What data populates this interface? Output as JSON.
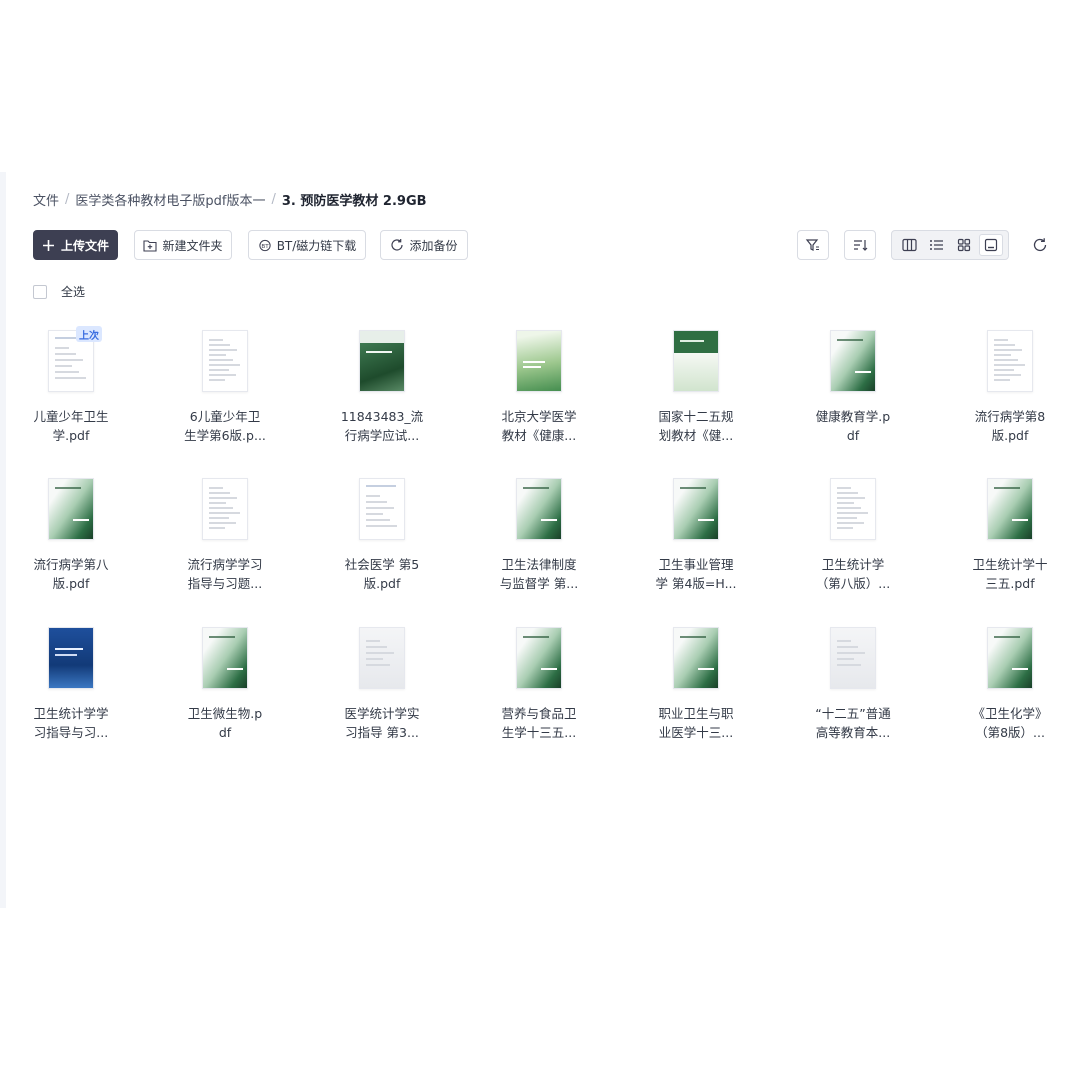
{
  "breadcrumb": {
    "root": "文件",
    "parent": "医学类各种教材电子版pdf版本一",
    "current": "3. 预防医学教材 2.9GB"
  },
  "toolbar": {
    "upload_label": "上传文件",
    "new_folder_label": "新建文件夹",
    "bt_label": "BT/磁力链下载",
    "backup_label": "添加备份",
    "filter_icon": "filter-icon",
    "sort_icon": "sort-icon",
    "views": [
      "column-view-icon",
      "list-view-icon",
      "grid-view-icon",
      "thumbnail-view-icon"
    ],
    "refresh_icon": "refresh-icon"
  },
  "select_all_label": "全选",
  "badge_label": "上次",
  "files": [
    {
      "name1": "儿童少年卫生",
      "name2": "学.pdf",
      "style": "plain"
    },
    {
      "name1": "6儿童少年卫",
      "name2": "生学第6版.p...",
      "style": "doc"
    },
    {
      "name1": "11843483_流",
      "name2": "行病学应试...",
      "style": "green-dark"
    },
    {
      "name1": "北京大学医学",
      "name2": "教材《健康...",
      "style": "green-light"
    },
    {
      "name1": "国家十二五规",
      "name2": "划教材《健...",
      "style": "green-top"
    },
    {
      "name1": "健康教育学.p",
      "name2": "df",
      "style": "green-fade"
    },
    {
      "name1": "流行病学第8",
      "name2": "版.pdf",
      "style": "doc"
    },
    {
      "name1": "流行病学第八",
      "name2": "版.pdf",
      "style": "green-fade"
    },
    {
      "name1": "流行病学学习",
      "name2": "指导与习题...",
      "style": "doc"
    },
    {
      "name1": "社会医学 第5",
      "name2": "版.pdf",
      "style": "plain"
    },
    {
      "name1": "卫生法律制度",
      "name2": "与监督学 第...",
      "style": "green-fade"
    },
    {
      "name1": "卫生事业管理",
      "name2": "学 第4版=H...",
      "style": "green-fade"
    },
    {
      "name1": "卫生统计学",
      "name2": "（第八版）...",
      "style": "doc"
    },
    {
      "name1": "卫生统计学十",
      "name2": "三五.pdf",
      "style": "green-fade"
    },
    {
      "name1": "卫生统计学学",
      "name2": "习指导与习...",
      "style": "blue"
    },
    {
      "name1": "卫生微生物.p",
      "name2": "df",
      "style": "green-fade"
    },
    {
      "name1": "医学统计学实",
      "name2": "习指导 第3...",
      "style": "gray"
    },
    {
      "name1": "营养与食品卫",
      "name2": "生学十三五...",
      "style": "green-fade"
    },
    {
      "name1": "职业卫生与职",
      "name2": "业医学十三...",
      "style": "green-fade"
    },
    {
      "name1": "“十二五”普通",
      "name2": "高等教育本...",
      "style": "gray"
    },
    {
      "name1": "《卫生化学》",
      "name2": "（第8版）...",
      "style": "green-fade"
    }
  ]
}
